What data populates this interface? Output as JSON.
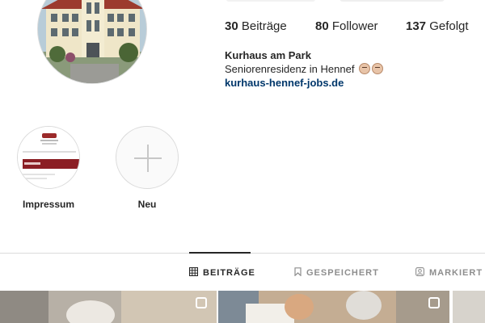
{
  "profile": {
    "stats": {
      "posts_count": "30",
      "posts_label": "Beiträge",
      "followers_count": "80",
      "followers_label": "Follower",
      "following_count": "137",
      "following_label": "Gefolgt"
    },
    "bio": {
      "name": "Kurhaus am Park",
      "description": "Seniorenresidenz in Hennef",
      "link": "kurhaus-hennef-jobs.de"
    }
  },
  "highlights": [
    {
      "label": "Impressum",
      "icon": "impressum-cover"
    },
    {
      "label": "Neu",
      "icon": "plus-icon"
    }
  ],
  "tabs": [
    {
      "label": "BEITRÄGE",
      "icon": "grid-icon",
      "active": true
    },
    {
      "label": "GESPEICHERT",
      "icon": "bookmark-icon",
      "active": false
    },
    {
      "label": "MARKIERT",
      "icon": "tag-person-icon",
      "active": false
    }
  ],
  "colors": {
    "text": "#262626",
    "muted": "#8e8e8e",
    "link": "#00376b",
    "border": "#dbdbdb"
  }
}
